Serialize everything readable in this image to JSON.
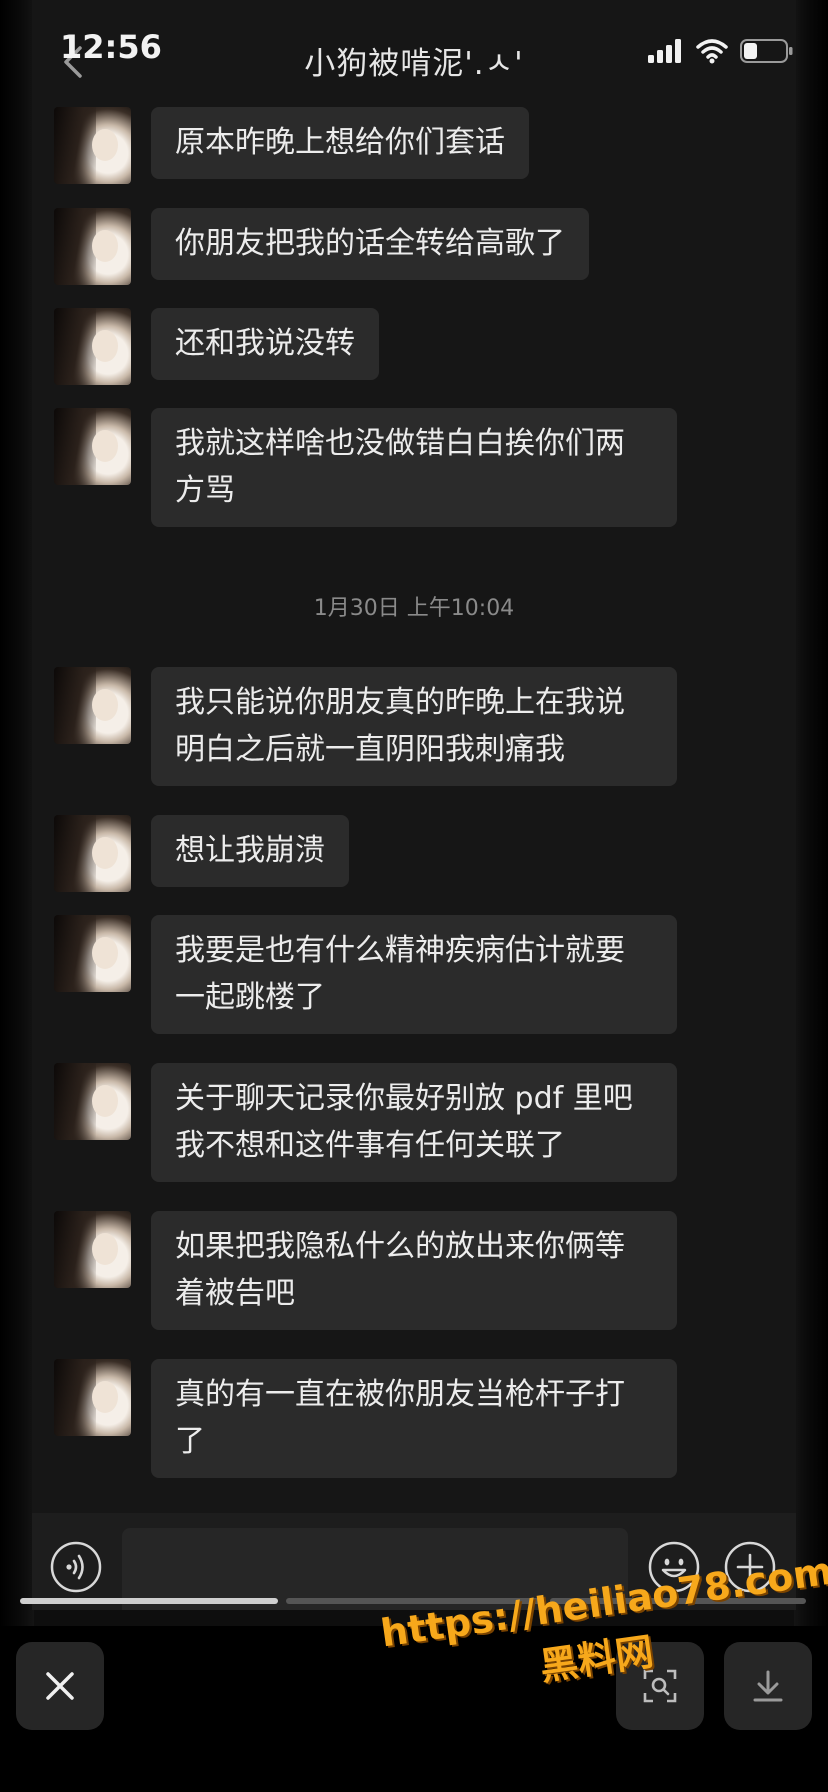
{
  "status_bar": {
    "time": "12:56",
    "title": "小狗被啃泥'.ㅅ'",
    "icons": [
      "signal-icon",
      "wifi-icon",
      "battery-icon"
    ]
  },
  "messages": [
    {
      "text": "原本昨晚上想给你们套话"
    },
    {
      "text": "你朋友把我的话全转给高歌了"
    },
    {
      "text": "还和我说没转"
    },
    {
      "text": "我就这样啥也没做错白白挨你们两方骂"
    },
    {
      "text": "我只能说你朋友真的昨晚上在我说明白之后就一直阴阳我刺痛我"
    },
    {
      "text": "想让我崩溃"
    },
    {
      "text": "我要是也有什么精神疾病估计就要一起跳楼了"
    },
    {
      "text": "关于聊天记录你最好别放 pdf 里吧我不想和这件事有任何关联了"
    },
    {
      "text": "如果把我隐私什么的放出来你俩等着被告吧"
    },
    {
      "text": "真的有一直在被你朋友当枪杆子打了"
    }
  ],
  "timestamp": "1月30日 上午10:04",
  "input": {
    "icons": [
      "voice-icon",
      "emoji-icon",
      "plus-icon"
    ]
  },
  "gallery": {
    "current_index": 1,
    "total": 3
  },
  "viewer": {
    "icons": [
      "close-icon",
      "scan-icon",
      "download-icon"
    ]
  },
  "watermark": {
    "url": "https://heiliao78.com",
    "name": "黑料网"
  },
  "colors": {
    "background": "#161616",
    "bubble": "#2b2b2b",
    "text": "#ececec",
    "watermark": "#f7a81b"
  }
}
